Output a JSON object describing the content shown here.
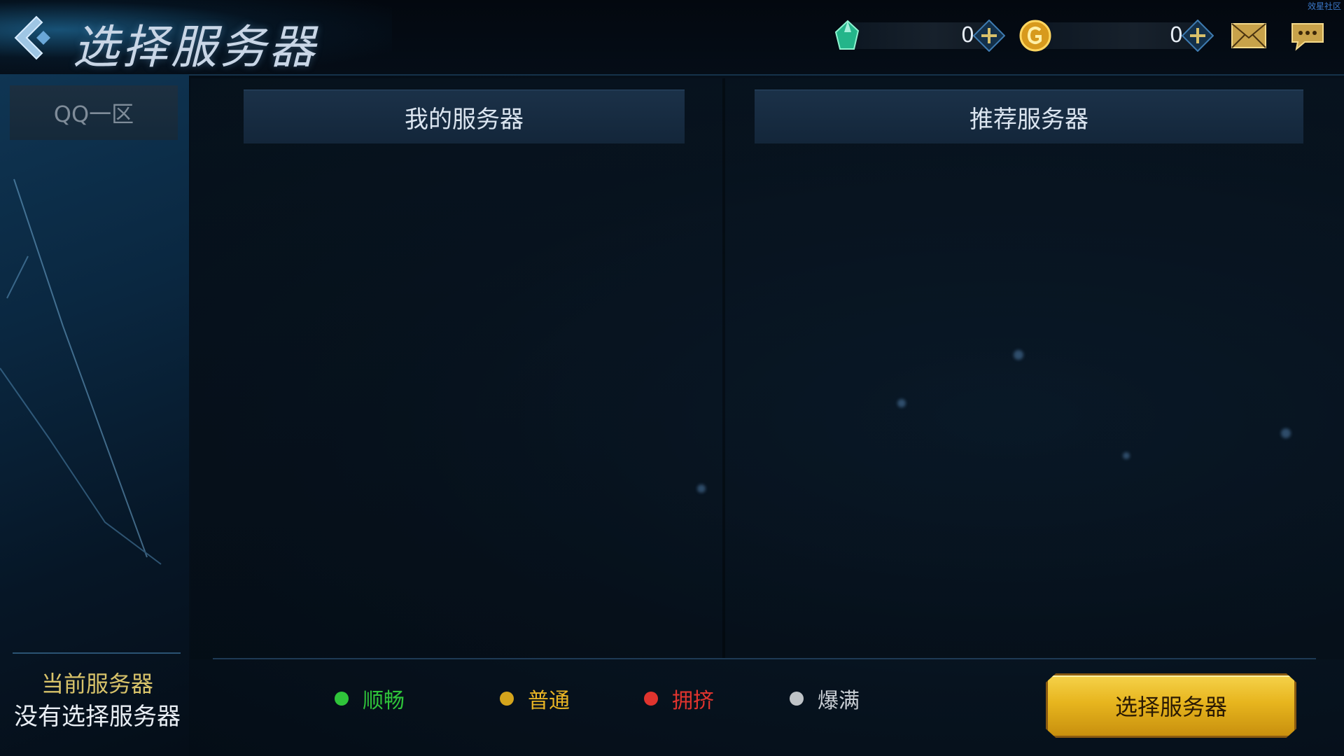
{
  "header": {
    "title": "选择服务器",
    "gems": "0",
    "coins": "0",
    "watermark": "效星社区"
  },
  "sidebar": {
    "zone_tab": "QQ一区",
    "current_label": "当前服务器",
    "current_value": "没有选择服务器"
  },
  "main": {
    "my_servers": "我的服务器",
    "recommended": "推荐服务器"
  },
  "legend": [
    {
      "label": "顺畅",
      "color": "#2fc43a"
    },
    {
      "label": "普通",
      "color": "#d4a41c"
    },
    {
      "label": "拥挤",
      "color": "#e0342e"
    },
    {
      "label": "爆满",
      "color": "#bfc3c7"
    }
  ],
  "select_button": "选择服务器",
  "icons": {
    "back": "back-arrow-icon",
    "gem": "gem-icon",
    "coin": "coin-icon",
    "mail": "mail-icon",
    "chat": "chat-icon"
  }
}
